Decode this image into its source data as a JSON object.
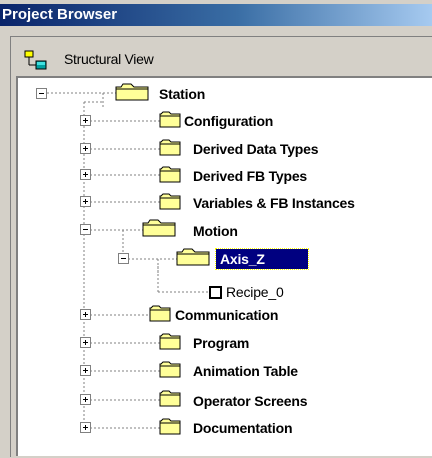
{
  "window": {
    "title": "Project Browser"
  },
  "view": {
    "label": "Structural View",
    "icon": "structural-view-icon"
  },
  "tree": {
    "root": {
      "label": "Station",
      "expanded": true
    },
    "items": [
      {
        "label": "Configuration",
        "expanded": false
      },
      {
        "label": "Derived Data Types",
        "expanded": false
      },
      {
        "label": "Derived FB Types",
        "expanded": false
      },
      {
        "label": "Variables & FB Instances",
        "expanded": false
      },
      {
        "label": "Motion",
        "expanded": true
      },
      {
        "label": "Axis_Z",
        "expanded": true,
        "selected": true
      },
      {
        "label": "Recipe_0"
      },
      {
        "label": "Communication",
        "expanded": false
      },
      {
        "label": "Program",
        "expanded": false
      },
      {
        "label": "Animation Table",
        "expanded": false
      },
      {
        "label": "Operator Screens",
        "expanded": false
      },
      {
        "label": "Documentation",
        "expanded": false
      }
    ]
  },
  "colors": {
    "title_bar": "#0a246a",
    "selection": "#000080",
    "folder": "#ffff99"
  }
}
